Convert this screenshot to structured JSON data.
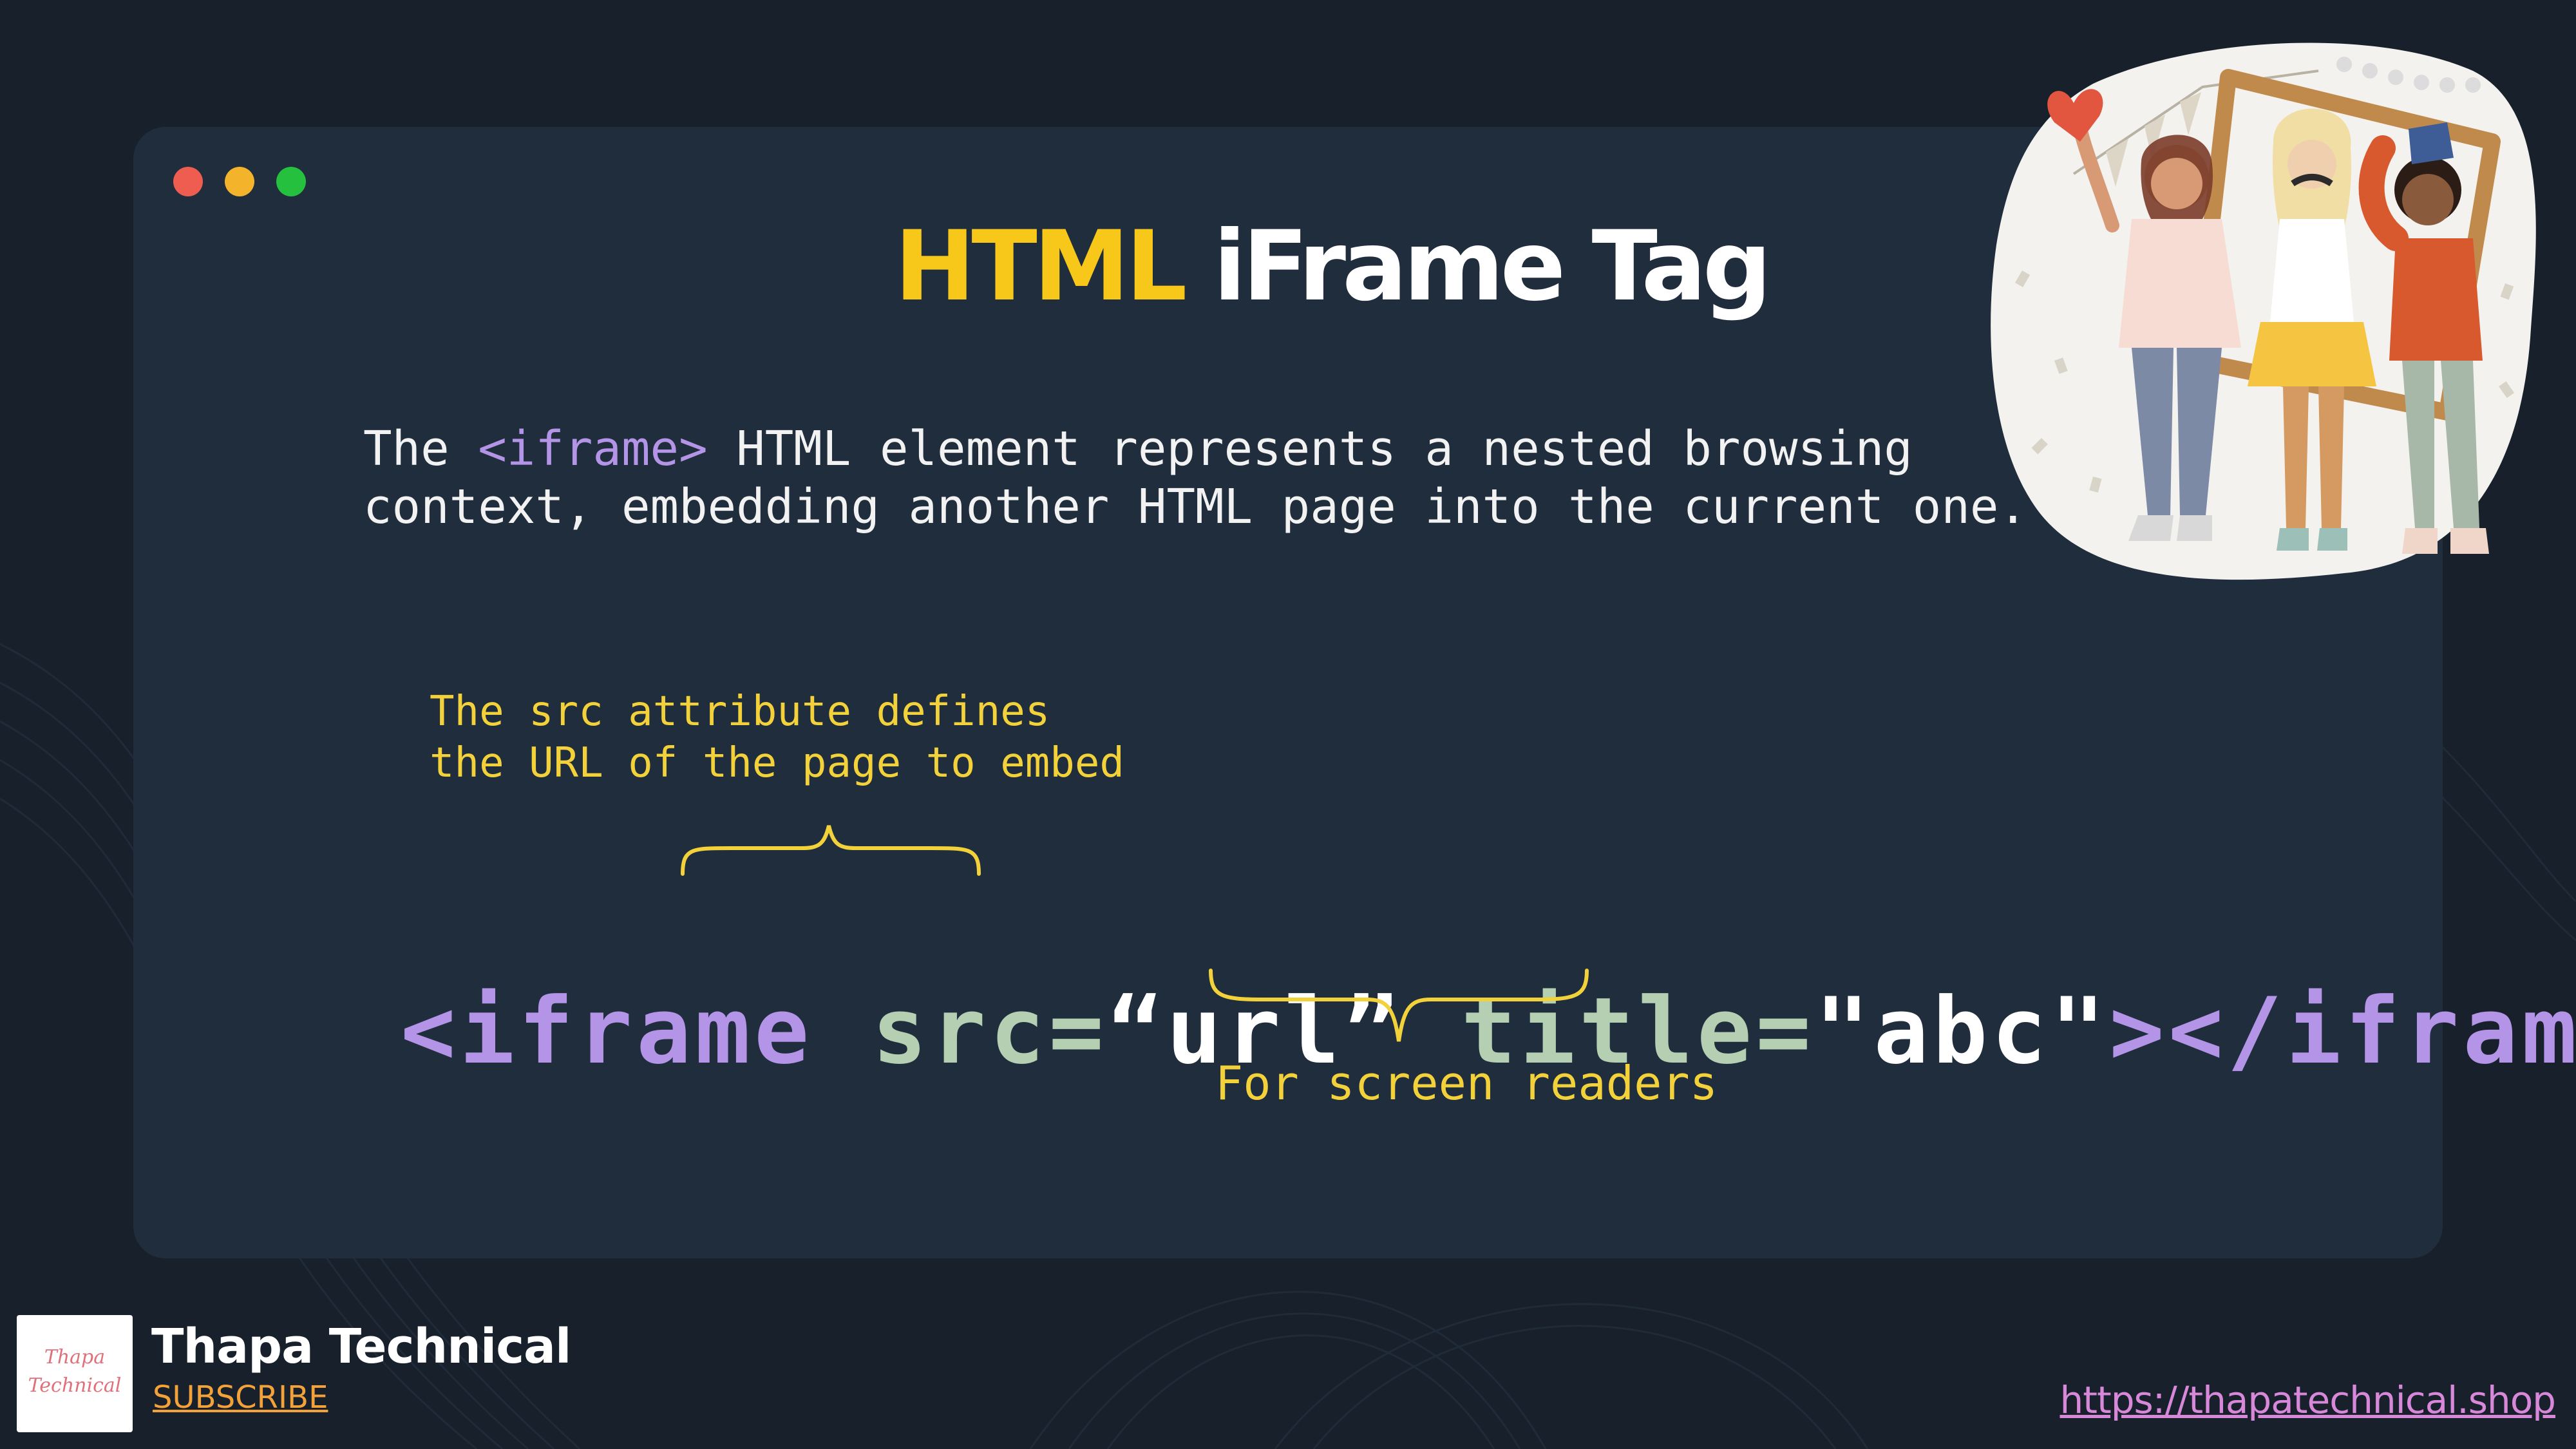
{
  "window": {
    "controls": [
      "red",
      "yellow",
      "green"
    ]
  },
  "slide": {
    "title_highlight": "HTML",
    "title_rest": " iFrame Tag",
    "description": {
      "line1_before": "The ",
      "line1_tag": "<iframe>",
      "line1_after": " HTML element represents a nested browsing",
      "line2": "context, embedding another HTML page into the current one."
    },
    "note_src": {
      "line1": "The src attribute defines",
      "line2": "the URL of the page to embed"
    },
    "note_title": "For screen readers",
    "code": {
      "open_tag": "<iframe",
      "src_attr": "src=",
      "src_value": "“url”",
      "title_attr": "title=",
      "title_value": "\"abc\"",
      "close_tag": "></iframe>"
    }
  },
  "footer": {
    "logo_line1": "Thapa",
    "logo_line2": "Technical",
    "channel_name": "Thapa Technical",
    "subscribe_label": "SUBSCRIBE",
    "site_url": "https://thapatechnical.shop"
  },
  "colors": {
    "background": "#17202b",
    "card": "#1f2d3d",
    "title_highlight": "#f7c71a",
    "tag_purple": "#b394e6",
    "attr_green": "#b5cfb3",
    "note_yellow": "#f2d13a",
    "subscribe_orange": "#f3a23a",
    "url_pink": "#d888d8"
  },
  "icons": [
    "traffic-light-close-icon",
    "traffic-light-minimize-icon",
    "traffic-light-maximize-icon",
    "curly-brace-icon"
  ]
}
